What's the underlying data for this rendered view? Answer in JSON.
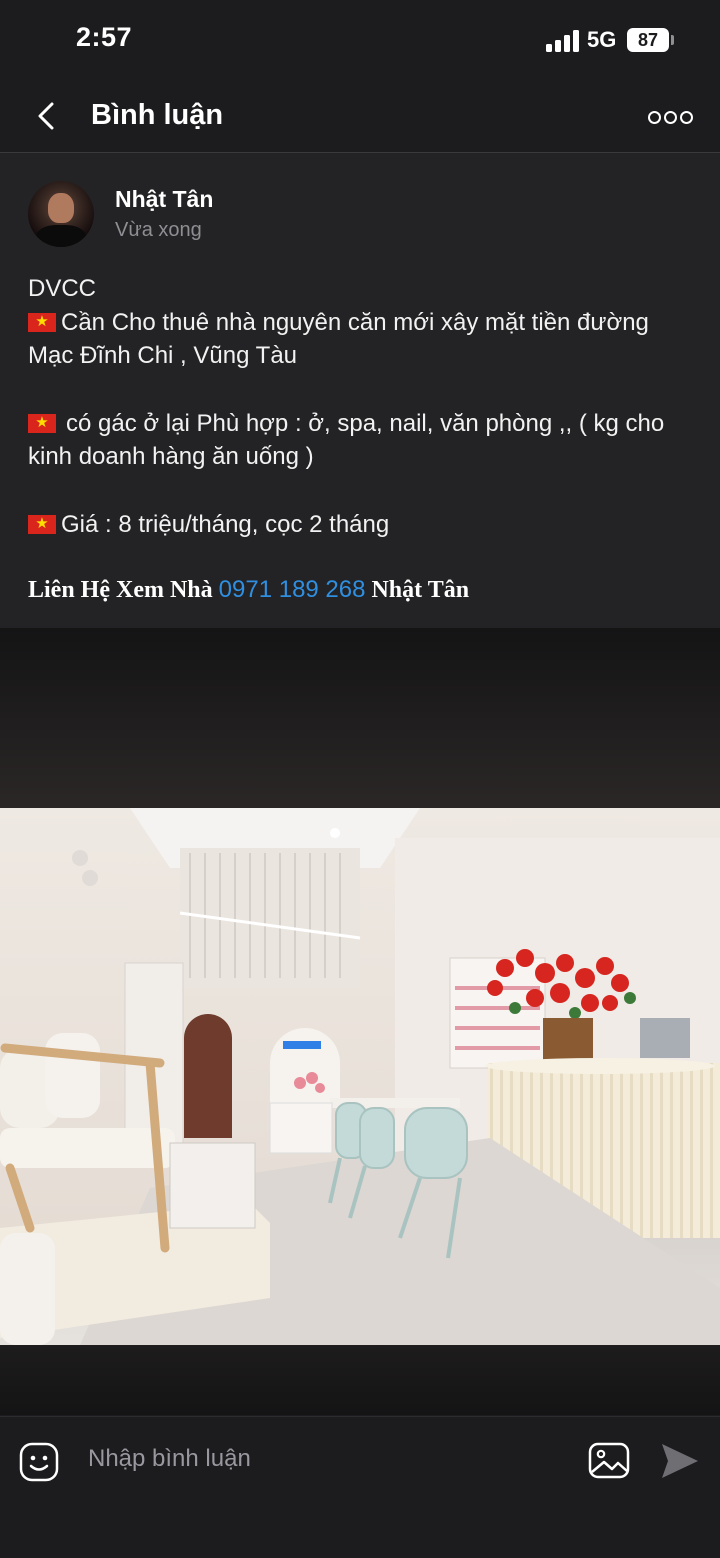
{
  "status_bar": {
    "time": "2:57",
    "network": "5G",
    "battery": "87"
  },
  "nav": {
    "title": "Bình luận",
    "back_icon": "chevron-left-icon",
    "more_icon": "more-dots-icon"
  },
  "post": {
    "author": "Nhật Tân",
    "time": "Vừa xong",
    "lines": {
      "l1": "DVCC",
      "l2": "Cần Cho thuê nhà nguyên căn mới xây mặt tiền đường Mạc Đĩnh Chi , Vũng Tàu",
      "l3": "có gác ở lại Phù hợp : ở, spa, nail, văn phòng ,, ( kg cho kinh doanh hàng ăn uống )",
      "l4": "Giá : 8 triệu/tháng, cọc 2 tháng"
    },
    "flag_icon": "vietnam-flag-icon",
    "contact": {
      "prefix": "Liên Hệ Xem Nhà",
      "phone": "0971 189 268",
      "suffix": "Nhật Tân"
    },
    "photo_icon": "shop-interior-photo"
  },
  "comment_bar": {
    "placeholder": "Nhập bình luận",
    "emoji_icon": "emoji-icon",
    "image_icon": "image-icon",
    "send_icon": "send-icon"
  },
  "colors": {
    "background": "#1c1c1e",
    "post_background": "#232325",
    "link": "#2f8fe0",
    "muted": "#8e8e93",
    "flag_red": "#da251d",
    "flag_star": "#ffde00"
  }
}
